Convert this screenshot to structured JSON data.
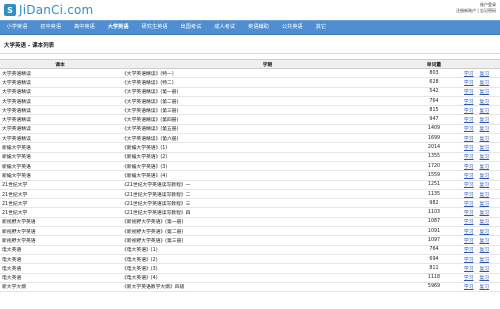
{
  "site": {
    "logo_badge": "S",
    "logo_text": "JiDanCi.com"
  },
  "top_links": {
    "account": "账户登录",
    "register": "注册新账户",
    "forgot": "忘记密码"
  },
  "nav": [
    "小学英语",
    "初中英语",
    "高中英语",
    "大学英语",
    "研究生英语",
    "出国考试",
    "成人考试",
    "英语辅助",
    "公共英语",
    "其它"
  ],
  "page": {
    "title": "大学英语 - 课本列表"
  },
  "table": {
    "headers": [
      "课本",
      "学期",
      "单词量",
      ""
    ],
    "study_label": "学习",
    "review_label": "复习",
    "rows": [
      {
        "book": "大学英语精读",
        "term": "《大学英语精读》(特一)",
        "count": "803"
      },
      {
        "book": "大学英语精读",
        "term": "《大学英语精读》(特二)",
        "count": "628"
      },
      {
        "book": "大学英语精读",
        "term": "《大学英语精读》(第一册)",
        "count": "542"
      },
      {
        "book": "大学英语精读",
        "term": "《大学英语精读》(第二册)",
        "count": "764"
      },
      {
        "book": "大学英语精读",
        "term": "《大学英语精读》(第三册)",
        "count": "815"
      },
      {
        "book": "大学英语精读",
        "term": "《大学英语精读》(第四册)",
        "count": "947"
      },
      {
        "book": "大学英语精读",
        "term": "《大学英语精读》(第五册)",
        "count": "1409"
      },
      {
        "book": "大学英语精读",
        "term": "《大学英语精读》(第六册)",
        "count": "1699"
      },
      {
        "book": "新编大学英语",
        "term": "《新编大学英语》(1)",
        "count": "2014"
      },
      {
        "book": "新编大学英语",
        "term": "《新编大学英语》(2)",
        "count": "1355"
      },
      {
        "book": "新编大学英语",
        "term": "《新编大学英语》(3)",
        "count": "1720"
      },
      {
        "book": "新编大学英语",
        "term": "《新编大学英语》(4)",
        "count": "1559"
      },
      {
        "book": "21世纪大学",
        "term": "《21世纪大学英语读写教程》一",
        "count": "1251"
      },
      {
        "book": "21世纪大学",
        "term": "《21世纪大学英语读写教程》二",
        "count": "1135"
      },
      {
        "book": "21世纪大学",
        "term": "《21世纪大学英语读写教程》三",
        "count": "982"
      },
      {
        "book": "21世纪大学",
        "term": "《21世纪大学英语读写教程》四",
        "count": "1103"
      },
      {
        "book": "新视野大学英语",
        "term": "《新视野大学英语》(第一册)",
        "count": "1087"
      },
      {
        "book": "新视野大学英语",
        "term": "《新视野大学英语》(第二册)",
        "count": "1091"
      },
      {
        "book": "新视野大学英语",
        "term": "《新视野大学英语》(第三册)",
        "count": "1097"
      },
      {
        "book": "电大英语",
        "term": "《电大英语》(1)",
        "count": "764"
      },
      {
        "book": "电大英语",
        "term": "《电大英语》(2)",
        "count": "694"
      },
      {
        "book": "电大英语",
        "term": "《电大英语》(3)",
        "count": "811"
      },
      {
        "book": "电大英语",
        "term": "《电大英语》(4)",
        "count": "1118"
      },
      {
        "book": "新大学大纲",
        "term": "《新大学英语教学大纲》四级",
        "count": "5969"
      }
    ]
  }
}
